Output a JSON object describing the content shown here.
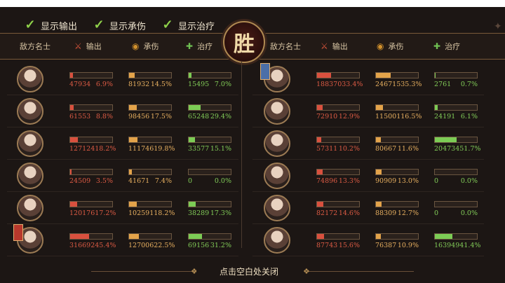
{
  "toggles": [
    {
      "label": "显示输出",
      "checked": true
    },
    {
      "label": "显示承伤",
      "checked": true
    },
    {
      "label": "显示治疗",
      "checked": true
    }
  ],
  "victory_text": "胜",
  "left_header": {
    "name": "敌方名士",
    "atk": "输出",
    "def": "承伤",
    "heal": "治疗"
  },
  "right_header": {
    "name": "敌方名士",
    "atk": "输出",
    "def": "承伤",
    "heal": "治疗"
  },
  "left_rows": [
    {
      "badge": "",
      "atk": {
        "v": "47934",
        "p": "6.9%",
        "f": 0.069
      },
      "def": {
        "v": "81932",
        "p": "14.5%",
        "f": 0.145
      },
      "heal": {
        "v": "15495",
        "p": "7.0%",
        "f": 0.07
      }
    },
    {
      "badge": "",
      "atk": {
        "v": "61553",
        "p": "8.8%",
        "f": 0.088
      },
      "def": {
        "v": "98456",
        "p": "17.5%",
        "f": 0.175
      },
      "heal": {
        "v": "65248",
        "p": "29.4%",
        "f": 0.294
      }
    },
    {
      "badge": "",
      "atk": {
        "v": "127124",
        "p": "18.2%",
        "f": 0.182
      },
      "def": {
        "v": "111746",
        "p": "19.8%",
        "f": 0.198
      },
      "heal": {
        "v": "33577",
        "p": "15.1%",
        "f": 0.151
      }
    },
    {
      "badge": "",
      "atk": {
        "v": "24509",
        "p": "3.5%",
        "f": 0.035
      },
      "def": {
        "v": "41671",
        "p": "7.4%",
        "f": 0.074
      },
      "heal": {
        "v": "0",
        "p": "0.0%",
        "f": 0
      }
    },
    {
      "badge": "",
      "atk": {
        "v": "120176",
        "p": "17.2%",
        "f": 0.172
      },
      "def": {
        "v": "102591",
        "p": "18.2%",
        "f": 0.182
      },
      "heal": {
        "v": "38289",
        "p": "17.3%",
        "f": 0.173
      }
    },
    {
      "badge": "red",
      "atk": {
        "v": "316692",
        "p": "45.4%",
        "f": 0.454
      },
      "def": {
        "v": "127006",
        "p": "22.5%",
        "f": 0.225
      },
      "heal": {
        "v": "69156",
        "p": "31.2%",
        "f": 0.312
      }
    }
  ],
  "right_rows": [
    {
      "badge": "blue",
      "atk": {
        "v": "188370",
        "p": "33.4%",
        "f": 0.334
      },
      "def": {
        "v": "246715",
        "p": "35.3%",
        "f": 0.353
      },
      "heal": {
        "v": "2761",
        "p": "0.7%",
        "f": 0.007
      }
    },
    {
      "badge": "",
      "atk": {
        "v": "72910",
        "p": "12.9%",
        "f": 0.129
      },
      "def": {
        "v": "115001",
        "p": "16.5%",
        "f": 0.165
      },
      "heal": {
        "v": "24191",
        "p": "6.1%",
        "f": 0.061
      }
    },
    {
      "badge": "",
      "atk": {
        "v": "57311",
        "p": "10.2%",
        "f": 0.102
      },
      "def": {
        "v": "80667",
        "p": "11.6%",
        "f": 0.116
      },
      "heal": {
        "v": "204734",
        "p": "51.7%",
        "f": 0.517
      }
    },
    {
      "badge": "",
      "atk": {
        "v": "74896",
        "p": "13.3%",
        "f": 0.133
      },
      "def": {
        "v": "90909",
        "p": "13.0%",
        "f": 0.13
      },
      "heal": {
        "v": "0",
        "p": "0.0%",
        "f": 0
      }
    },
    {
      "badge": "",
      "atk": {
        "v": "82172",
        "p": "14.6%",
        "f": 0.146
      },
      "def": {
        "v": "88309",
        "p": "12.7%",
        "f": 0.127
      },
      "heal": {
        "v": "0",
        "p": "0.0%",
        "f": 0
      }
    },
    {
      "badge": "",
      "atk": {
        "v": "87743",
        "p": "15.6%",
        "f": 0.156
      },
      "def": {
        "v": "76387",
        "p": "10.9%",
        "f": 0.109
      },
      "heal": {
        "v": "163949",
        "p": "41.4%",
        "f": 0.414
      }
    }
  ],
  "close_text": "点击空白处关闭",
  "colors": {
    "atk": "#d9503e",
    "def": "#e3a34a",
    "heal": "#7ccc55",
    "frame": "#9c7b54"
  }
}
